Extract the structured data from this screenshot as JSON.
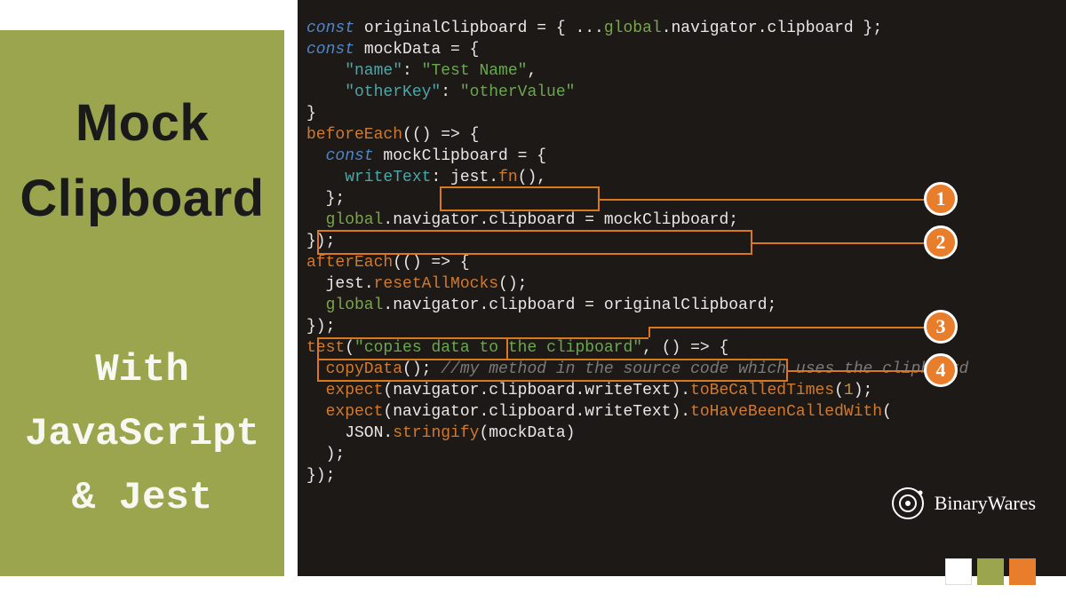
{
  "sidebar": {
    "top": {
      "line1": "Mock",
      "line2": "Clipboard"
    },
    "bottom": {
      "line1": "With",
      "line2": "JavaScript",
      "line3": "& Jest"
    }
  },
  "code": {
    "l1a": "const ",
    "l1b": "originalClipboard ",
    "l1c": "= { ...",
    "l1d": "global",
    "l1e": ".navigator.clipboard };",
    "l2a": "const ",
    "l2b": "mockData ",
    "l2c": "= {",
    "l3a": "    \"name\"",
    "l3b": ": ",
    "l3c": "\"Test Name\"",
    "l3d": ",",
    "l4a": "    \"otherKey\"",
    "l4b": ": ",
    "l4c": "\"otherValue\"",
    "l5": "}",
    "l6": "",
    "l7a": "beforeEach",
    "l7b": "(() => {",
    "l8a": "  const ",
    "l8b": "mockClipboard ",
    "l8c": "= {",
    "l9a": "    writeText",
    "l9b": ": ",
    "l9c": "jest",
    "l9d": ".",
    "l9e": "fn",
    "l9f": "(),",
    "l10": "  };",
    "l11a": "  global",
    "l11b": ".navigator.clipboard = mockClipboard;",
    "l12": "",
    "l13": "});",
    "l14": "",
    "l15a": "afterEach",
    "l15b": "(() => {",
    "l16a": "  jest",
    "l16b": ".",
    "l16c": "resetAllMocks",
    "l16d": "();",
    "l17a": "  global",
    "l17b": ".navigator.clipboard = originalClipboard;",
    "l18": "});",
    "l19": "",
    "l20a": "test",
    "l20b": "(",
    "l20c": "\"copies data to the clipboard\"",
    "l20d": ", () => {",
    "l21a": "  copyData",
    "l21b": "(); ",
    "l21c": "//my method in the source code which uses the clipboard",
    "l22a": "  expect",
    "l22b": "(navigator.clipboard.writeText).",
    "l22c": "toBeCalledTimes",
    "l22d": "(",
    "l22e": "1",
    "l22f": ");",
    "l23a": "  expect",
    "l23b": "(navigator.clipboard.writeText).",
    "l23c": "toHaveBeenCalledWith",
    "l23d": "(",
    "l24a": "    JSON",
    "l24b": ".",
    "l24c": "stringify",
    "l24d": "(mockData)",
    "l25": "  );",
    "l26": "});"
  },
  "annotations": {
    "badge1": "1",
    "badge2": "2",
    "badge3": "3",
    "badge4": "4"
  },
  "brand": {
    "name": "BinaryWares"
  },
  "colors": {
    "olive": "#9aa54e",
    "orange": "#e87d2c",
    "white": "#ffffff",
    "codebg": "#1d1916"
  }
}
